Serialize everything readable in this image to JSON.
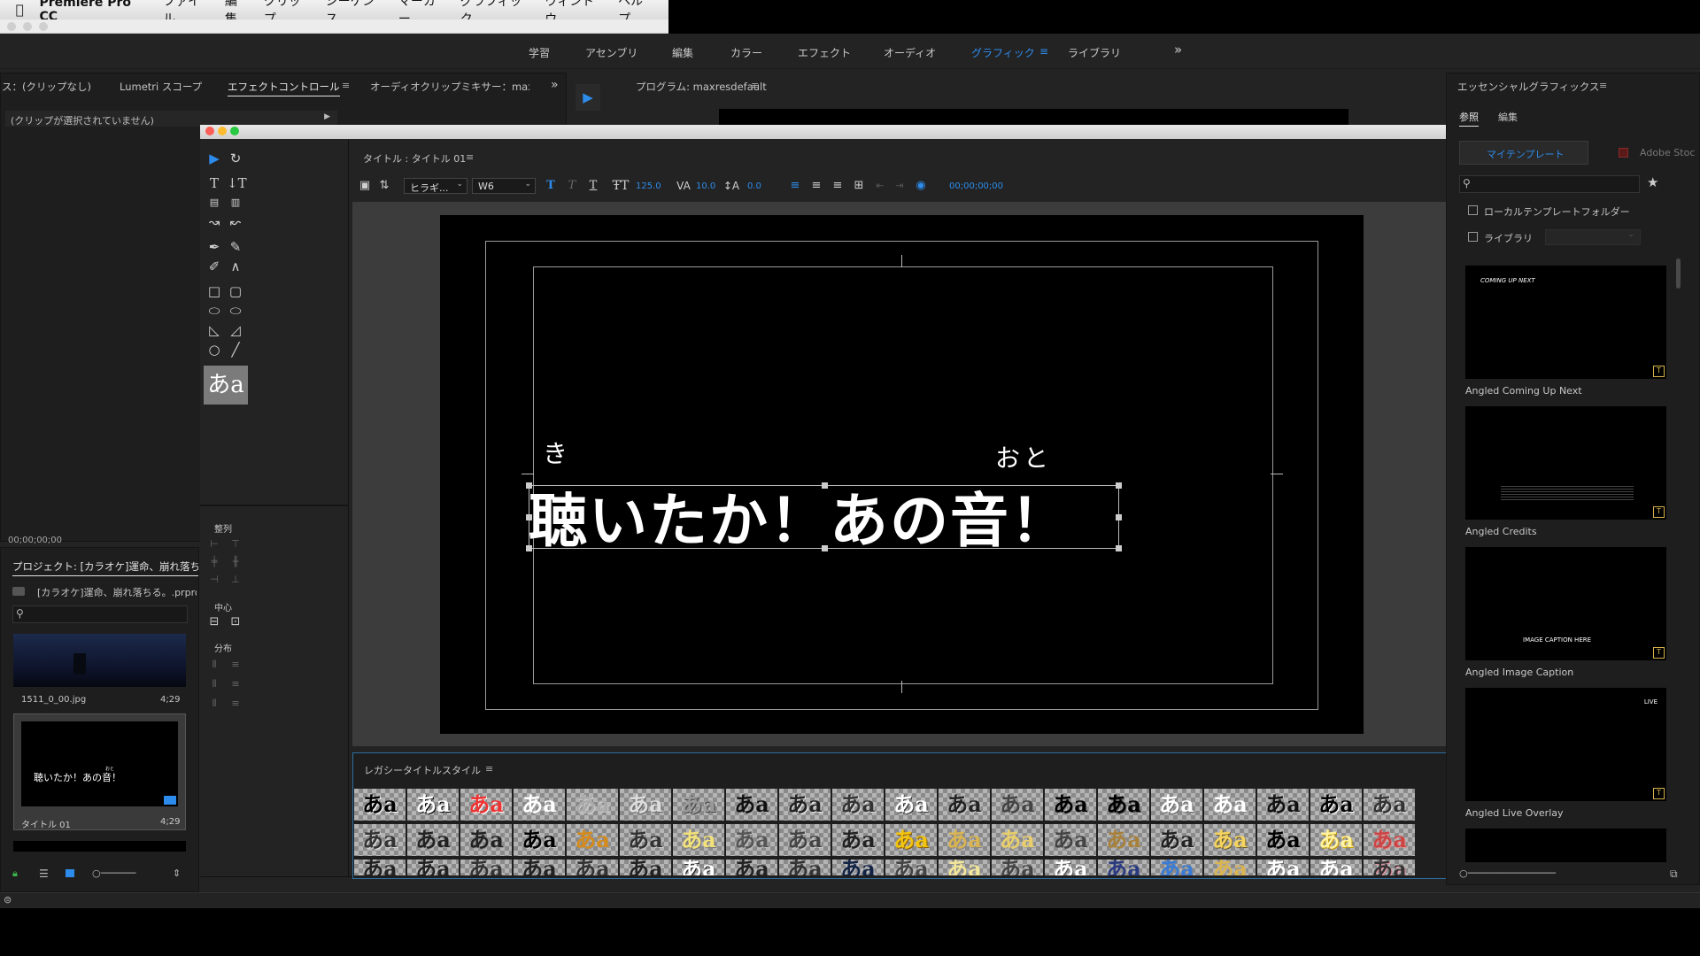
{
  "menubar": {
    "app": "Premiere Pro CC",
    "items": [
      "ファイル",
      "編集",
      "クリップ",
      "シーケンス",
      "マーカー",
      "グラフィック",
      "ウィンドウ",
      "ヘルプ"
    ]
  },
  "workspaces": {
    "items": [
      "学習",
      "アセンブリ",
      "編集",
      "カラー",
      "エフェクト",
      "オーディオ",
      "グラフィック",
      "ライブラリ"
    ],
    "active": "グラフィック",
    "more": "»"
  },
  "source_panel": {
    "tabs": [
      "ス：(クリップなし)",
      "Lumetri スコープ",
      "エフェクトコントロール",
      "オーディオクリップミキサー：maxres"
    ],
    "active": "エフェクトコントロール",
    "no_clip": "(クリップが選択されていません)",
    "timecode": "00;00;00;00"
  },
  "program": {
    "title": "プログラム: maxresdefault"
  },
  "project": {
    "title": "プロジェクト: [カラオケ]運命、崩れ落ちる。",
    "file": "[カラオケ]運命、崩れ落ちる。.prproj",
    "items": [
      {
        "name": "1511_0_00.jpg",
        "duration": "4;29"
      },
      {
        "name": "タイトル 01",
        "duration": "4;29",
        "preview": "聴いたか！あの音！",
        "preview_ruby": "おと"
      }
    ]
  },
  "title_designer": {
    "title": "タイトル : タイトル 01",
    "font": "ヒラギ...",
    "weight": "W6",
    "size": "125.0",
    "kerning": "10.0",
    "leading": "0.0",
    "timecode": "00;00;00;00",
    "style_sample": "あa",
    "align_section": "整列",
    "center_section": "中心",
    "distribute_section": "分布",
    "main_text": "聴いたか！あの音！",
    "ruby_ki": "き",
    "ruby_oto": "おと",
    "styles_title": "レガシータイトルスタイル",
    "swatch_text": "あa"
  },
  "essential_graphics": {
    "title": "エッセンシャルグラフィックス",
    "tabs": [
      "参照",
      "編集"
    ],
    "active_tab": "参照",
    "sub_tabs": [
      "マイテンプレート",
      "Adobe Stoc"
    ],
    "local_folder": "ローカルテンプレートフォルダー",
    "library": "ライブラリ",
    "templates": [
      {
        "name": "Angled Coming Up Next",
        "overlay": "COMING UP NEXT"
      },
      {
        "name": "Angled Credits",
        "overlay": ""
      },
      {
        "name": "Angled Image Caption",
        "overlay": "IMAGE CAPTION HERE"
      },
      {
        "name": "Angled Live Overlay",
        "overlay": "LIVE"
      }
    ]
  },
  "colors": {
    "accent": "#2d8ceb",
    "panel": "#1e1e1e",
    "chrome": "#232323"
  }
}
